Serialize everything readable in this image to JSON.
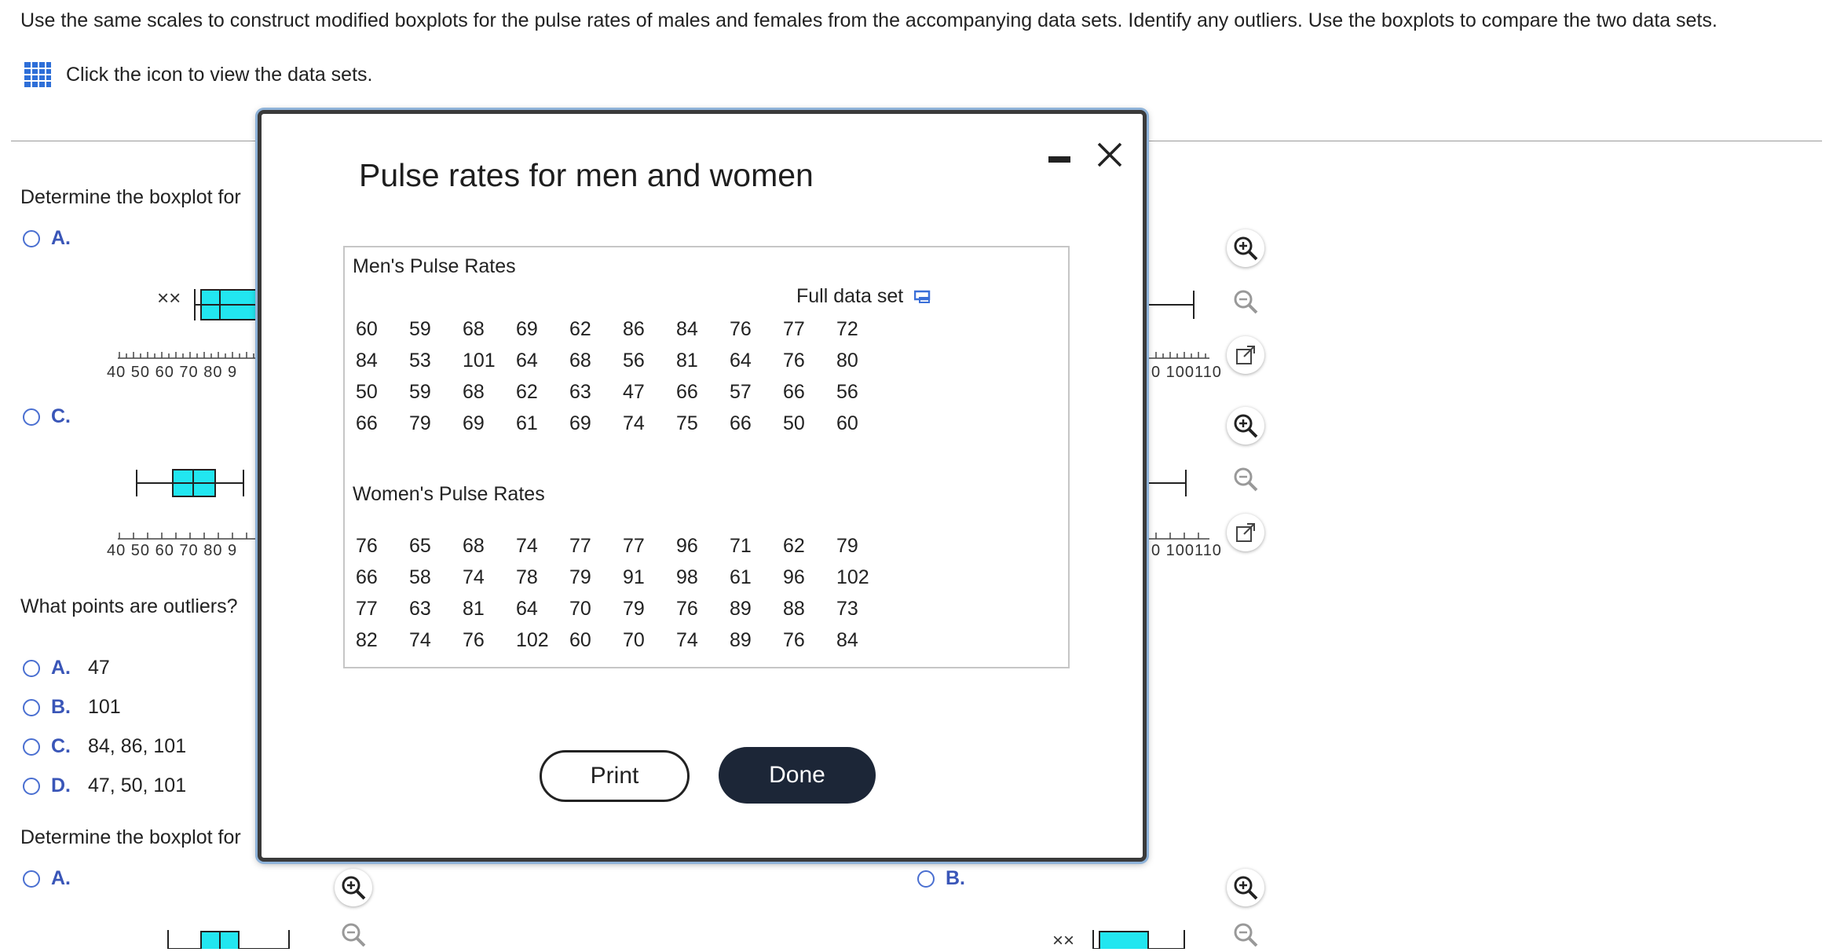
{
  "question": {
    "text": "Use the same scales to construct modified boxplots for the pulse rates of males and females from the accompanying data sets. Identify any outliers. Use the boxplots to compare the two data sets.",
    "data_link_text": "Click the icon to view the data sets."
  },
  "part1": {
    "prompt": "Determine the boxplot for",
    "options": [
      {
        "letter": "A.",
        "axis_left": "40  50  60  70  80  9",
        "axis_right": "0 100110",
        "outlier_marks": "××"
      },
      {
        "letter": "C.",
        "axis_left": "40  50  60  70  80  9",
        "axis_right": "0 100110"
      }
    ]
  },
  "part2": {
    "prompt": "What points are outliers?",
    "options": [
      {
        "letter": "A.",
        "value": "47"
      },
      {
        "letter": "B.",
        "value": "101"
      },
      {
        "letter": "C.",
        "value": "84, 86, 101"
      },
      {
        "letter": "D.",
        "value": "47, 50, 101"
      }
    ]
  },
  "part3": {
    "prompt": "Determine the boxplot for",
    "options": [
      {
        "letter": "A."
      },
      {
        "letter": "B.",
        "outlier_marks": "××"
      }
    ]
  },
  "dialog": {
    "title": "Pulse rates for men and women",
    "full_data_label": "Full data set",
    "men": {
      "title": "Men's Pulse Rates",
      "rows": [
        [
          "60",
          "59",
          "68",
          "69",
          "62",
          "86",
          "84",
          "76",
          "77",
          "72"
        ],
        [
          "84",
          "53",
          "101",
          "64",
          "68",
          "56",
          "81",
          "64",
          "76",
          "80"
        ],
        [
          "50",
          "59",
          "68",
          "62",
          "63",
          "47",
          "66",
          "57",
          "66",
          "56"
        ],
        [
          "66",
          "79",
          "69",
          "61",
          "69",
          "74",
          "75",
          "66",
          "50",
          "60"
        ]
      ]
    },
    "women": {
      "title": "Women's Pulse Rates",
      "rows": [
        [
          "76",
          "65",
          "68",
          "74",
          "77",
          "77",
          "96",
          "71",
          "62",
          "79"
        ],
        [
          "66",
          "58",
          "74",
          "78",
          "79",
          "91",
          "98",
          "61",
          "96",
          "102"
        ],
        [
          "77",
          "63",
          "81",
          "64",
          "70",
          "79",
          "76",
          "89",
          "88",
          "73"
        ],
        [
          "82",
          "74",
          "76",
          "102",
          "60",
          "70",
          "74",
          "89",
          "76",
          "84"
        ]
      ]
    },
    "print_label": "Print",
    "done_label": "Done"
  },
  "colors": {
    "box_fill": "#22e6f0",
    "option_letter": "#3a56b8",
    "radio_border": "#4a6fd1",
    "done_bg": "#1c2637"
  }
}
